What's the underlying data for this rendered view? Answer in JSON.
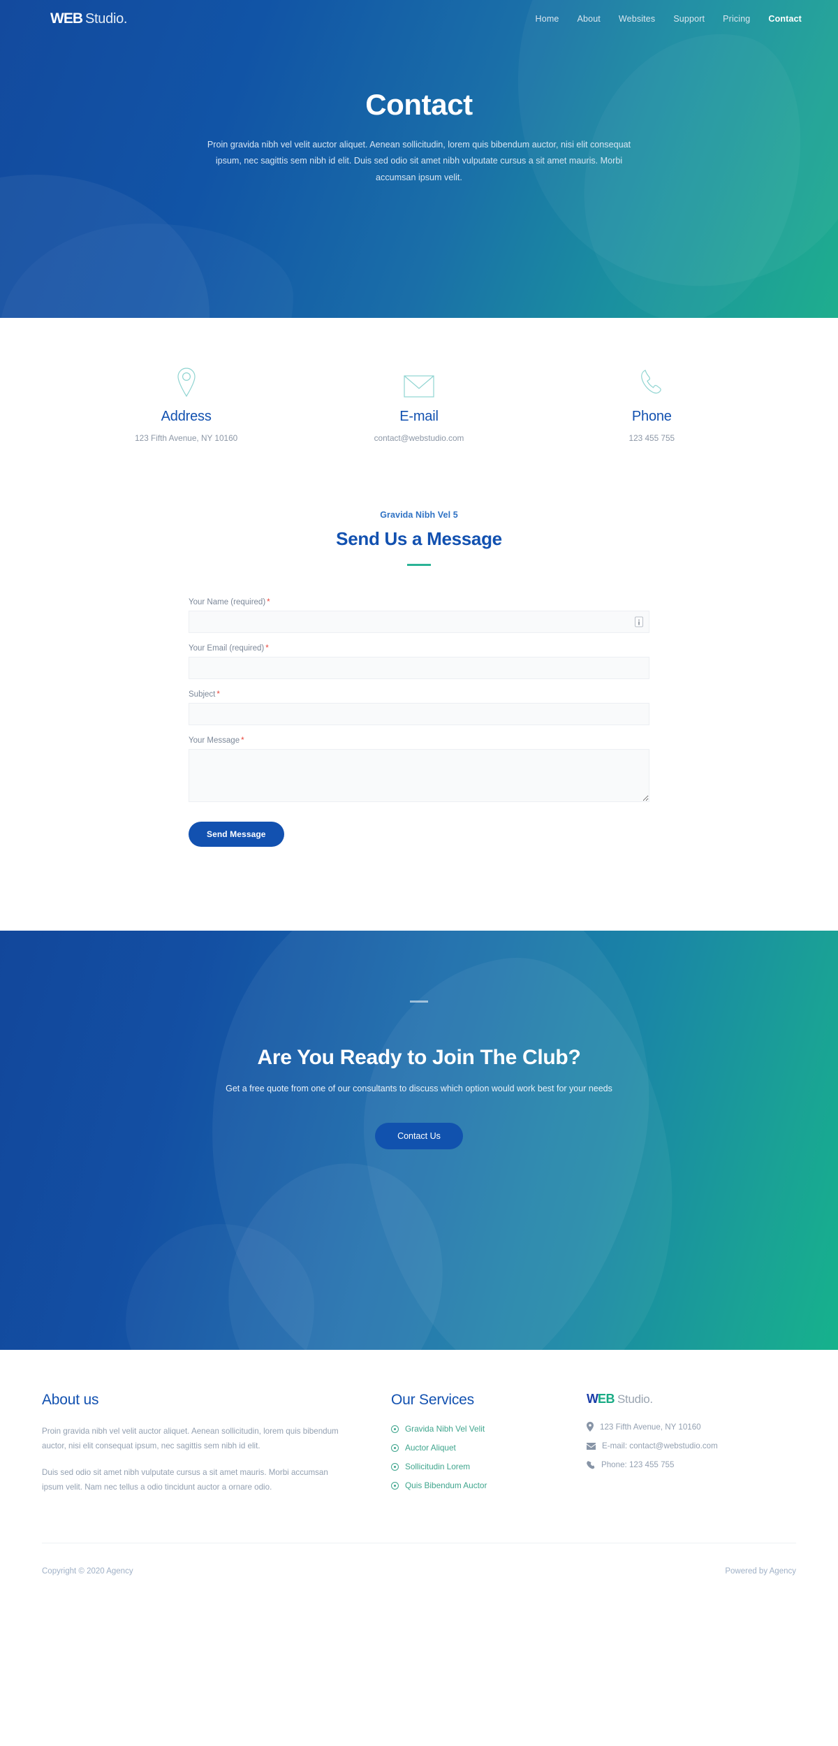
{
  "header": {
    "logo": {
      "web": "WEB",
      "studio": "Studio."
    },
    "nav": [
      {
        "label": "Home",
        "active": false
      },
      {
        "label": "About",
        "active": false
      },
      {
        "label": "Websites",
        "active": false
      },
      {
        "label": "Support",
        "active": false
      },
      {
        "label": "Pricing",
        "active": false
      },
      {
        "label": "Contact",
        "active": true
      }
    ]
  },
  "hero": {
    "title": "Contact",
    "subtitle": "Proin gravida nibh vel velit auctor aliquet. Aenean sollicitudin, lorem quis bibendum auctor, nisi elit consequat ipsum, nec sagittis sem nibh id elit. Duis sed odio sit amet nibh vulputate cursus a sit amet mauris. Morbi accumsan ipsum velit."
  },
  "contact_info": [
    {
      "icon": "map-pin-icon",
      "title": "Address",
      "text": "123 Fifth Avenue, NY 10160"
    },
    {
      "icon": "envelope-icon",
      "title": "E-mail",
      "text": "contact@webstudio.com"
    },
    {
      "icon": "phone-icon",
      "title": "Phone",
      "text": "123 455 755"
    }
  ],
  "form": {
    "eyebrow": "Gravida Nibh Vel 5",
    "title": "Send Us a Message",
    "required_mark": "*",
    "fields": [
      {
        "label": "Your Name (required)",
        "value": "",
        "placeholder": ""
      },
      {
        "label": "Your Email (required)",
        "value": "",
        "placeholder": ""
      },
      {
        "label": "Subject",
        "value": "",
        "placeholder": ""
      },
      {
        "label": "Your Message",
        "value": "",
        "placeholder": ""
      }
    ],
    "submit_label": "Send Message"
  },
  "cta": {
    "title": "Are You Ready to Join The Club?",
    "subtitle": "Get a free quote from one of our consultants to discuss which option would work best for your needs",
    "button_label": "Contact Us"
  },
  "footer": {
    "about": {
      "heading": "About us",
      "paragraph_1": "Proin gravida nibh vel velit auctor aliquet. Aenean sollicitudin, lorem quis bibendum auctor, nisi elit consequat ipsum, nec sagittis sem nibh id elit.",
      "paragraph_2": "Duis sed odio sit amet nibh vulputate cursus a sit amet mauris. Morbi accumsan ipsum velit. Nam nec tellus a odio tincidunt auctor a ornare odio."
    },
    "services": {
      "heading": "Our Services",
      "items": [
        "Gravida Nibh Vel Velit",
        "Auctor Aliquet",
        "Sollicitudin Lorem",
        "Quis Bibendum Auctor"
      ]
    },
    "company": {
      "logo": {
        "w": "W",
        "eb": "EB",
        "studio": "Studio."
      },
      "contacts": [
        {
          "icon": "map-pin-icon",
          "text": "123 Fifth Avenue, NY 10160"
        },
        {
          "icon": "envelope-icon",
          "text": "E-mail: contact@webstudio.com"
        },
        {
          "icon": "phone-icon",
          "text": "Phone: 123 455 755"
        }
      ]
    },
    "bottom": {
      "copyright": "Copyright © 2020 Agency",
      "powered": "Powered by Agency"
    }
  },
  "colors": {
    "brand_blue": "#1251b0",
    "brand_teal": "#2bb396",
    "hero_gradient_start": "#134a9e",
    "hero_gradient_end": "#1fae8e",
    "required_red": "#e8443a",
    "muted_text": "#93a0b1"
  }
}
